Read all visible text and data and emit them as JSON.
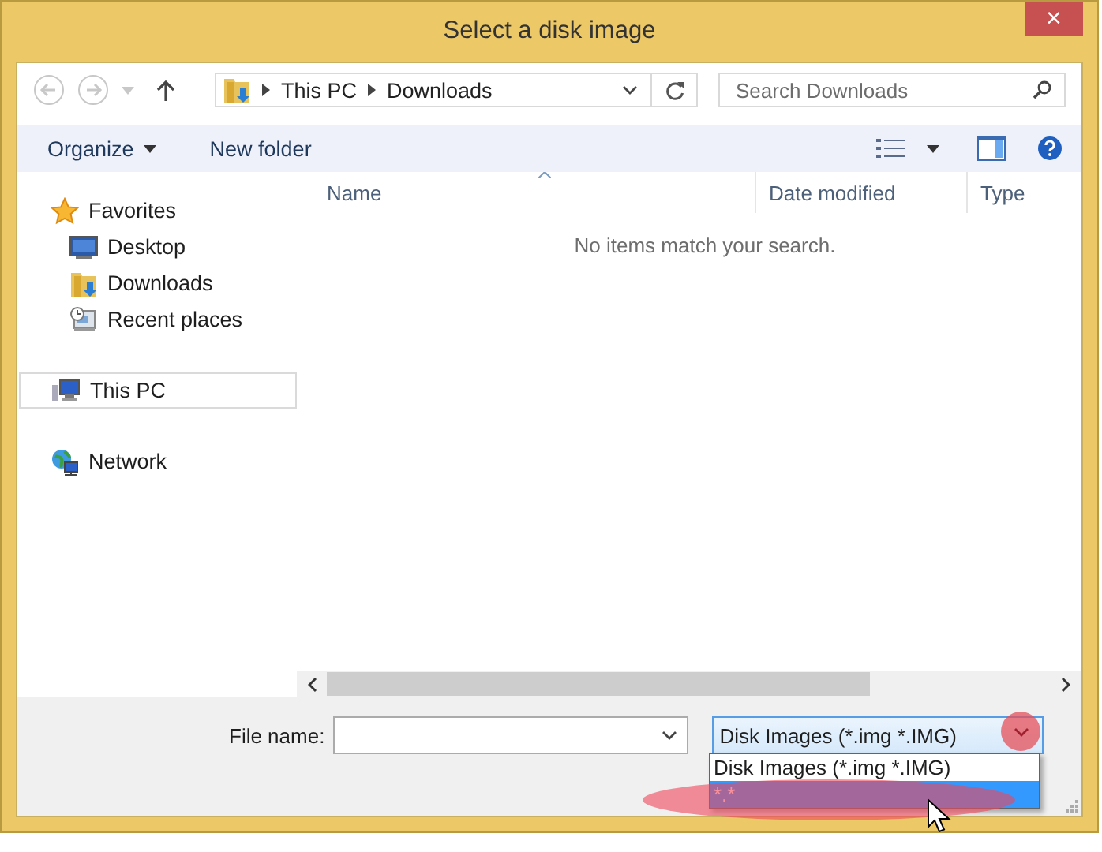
{
  "window": {
    "title": "Select a disk image",
    "close": "×"
  },
  "address": {
    "path": [
      "This PC",
      "Downloads"
    ]
  },
  "search": {
    "placeholder": "Search Downloads"
  },
  "toolbar": {
    "buttons": [
      {
        "label": "Organize",
        "kind": "menu"
      },
      {
        "label": "New folder",
        "kind": "plain"
      }
    ]
  },
  "sidebar": {
    "groups": [
      {
        "label": "Favorites",
        "kind": "star",
        "selected": false,
        "children": [
          {
            "label": "Desktop",
            "kind": "desktop",
            "selected": false
          },
          {
            "label": "Downloads",
            "kind": "download",
            "selected": false
          },
          {
            "label": "Recent places",
            "kind": "recent",
            "selected": false
          }
        ]
      },
      {
        "label": "This PC",
        "kind": "pc",
        "selected": true
      },
      {
        "label": "Network",
        "kind": "network",
        "selected": false
      }
    ]
  },
  "table": {
    "columns": [
      "Name",
      "Date modified",
      "Type"
    ],
    "empty_message": "No items match your search."
  },
  "footer": {
    "file_name_label": "File name:",
    "file_type": "Disk Images (*.img *.IMG)",
    "options": [
      {
        "label": "Disk Images (*.img *.IMG)",
        "selected": false
      },
      {
        "label": "*.*",
        "selected": true
      }
    ]
  }
}
